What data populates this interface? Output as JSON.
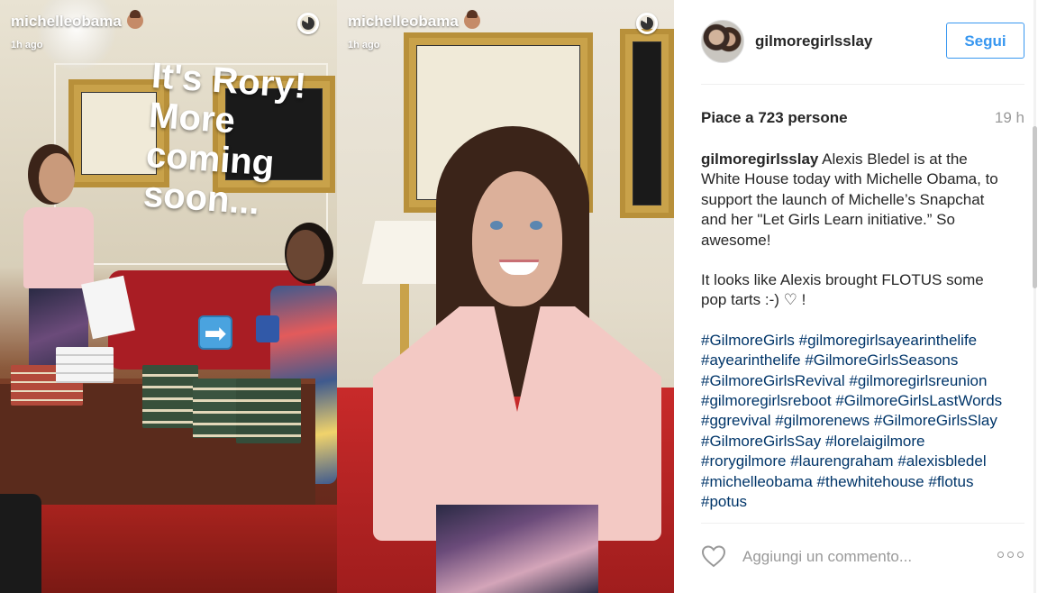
{
  "snaps": [
    {
      "username": "michelleobama",
      "time": "1h ago",
      "caption_lines": [
        "It's Rory!",
        "More",
        "coming",
        "soon..."
      ],
      "arrow": "➡"
    },
    {
      "username": "michelleobama",
      "time": "1h ago"
    }
  ],
  "post": {
    "username": "gilmoregirlsslay",
    "follow_label": "Segui",
    "likes": "Piace a 723 persone",
    "time_ago": "19 h",
    "caption_user": "gilmoregirlsslay",
    "caption_text": " Alexis Bledel is at the White House today with Michelle Obama, to support the launch of Michelle’s Snapchat and her \"Let Girls Learn initiative.” So awesome!",
    "caption_text_2": "It looks like Alexis brought FLOTUS some pop tarts :-) ♡ !",
    "hashtags": [
      "#GilmoreGirls",
      "#gilmoregirlsayearinthelife",
      "#ayearinthelife",
      "#GilmoreGirlsSeasons",
      "#GilmoreGirlsRevival",
      "#gilmoregirlsreunion",
      "#gilmoregirlsreboot",
      "#GilmoreGirlsLastWords",
      "#ggrevival",
      "#gilmorenews",
      "#GilmoreGirlsSlay",
      "#GilmoreGirlsSay",
      "#lorelaigilmore",
      "#rorygilmore",
      "#laurengraham",
      "#alexisbledel",
      "#michelleobama",
      "#thewhitehouse",
      "#flotus",
      "#potus"
    ],
    "comment_placeholder": "Aggiungi un commento..."
  },
  "colors": {
    "link": "#003569",
    "follow": "#3897f0",
    "text": "#262626",
    "muted": "#999999"
  },
  "icons": {
    "heart": "heart-icon",
    "more": "more-options-icon",
    "timer": "snap-timer-icon",
    "emoji": "emoji-icon"
  }
}
